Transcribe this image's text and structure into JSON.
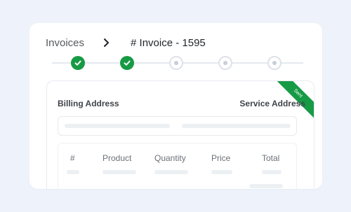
{
  "breadcrumb": {
    "root": "Invoices",
    "current": "# Invoice - 1595"
  },
  "stepper": {
    "steps": [
      {
        "status": "done",
        "icon": "check-icon"
      },
      {
        "status": "done",
        "icon": "check-icon"
      },
      {
        "status": "pending",
        "icon": "dot-icon"
      },
      {
        "status": "pending",
        "icon": "dot-icon"
      },
      {
        "status": "pending",
        "icon": "dot-icon"
      }
    ],
    "completed_count": 2
  },
  "invoice": {
    "status_ribbon": "Sent",
    "billing_label": "Billing Address",
    "service_label": "Service Address",
    "table": {
      "columns": [
        "#",
        "Product",
        "Quantity",
        "Price",
        "Total"
      ]
    }
  },
  "colors": {
    "background": "#eef3fb",
    "accent": "#179a45",
    "skeleton": "#edf0f3"
  }
}
